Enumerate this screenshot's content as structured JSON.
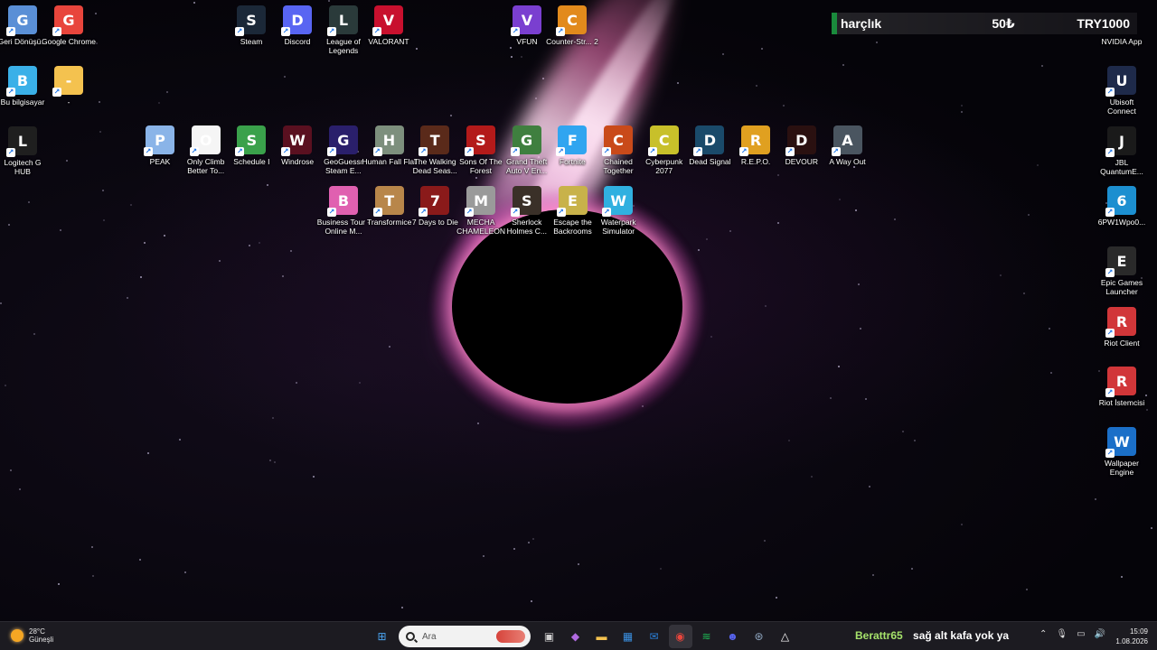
{
  "desktop": {
    "icons_left": [
      {
        "label": "Geri Dönüşü...",
        "icon": "recycle-bin-icon",
        "color": "#5a8fd6"
      },
      {
        "label": "Google Chrome",
        "icon": "chrome-icon",
        "color": "#e8453c"
      },
      {
        "label": "Bu bilgisayar",
        "icon": "computer-icon",
        "color": "#3ab0e8"
      },
      {
        "label": "-",
        "icon": "folder-icon",
        "color": "#f4c24f"
      },
      {
        "label": "Logitech G HUB",
        "icon": "logitech-icon",
        "color": "#1f1f1f"
      }
    ],
    "icons_top": [
      {
        "label": "Steam",
        "icon": "steam-icon",
        "color": "#1b2838"
      },
      {
        "label": "Discord",
        "icon": "discord-icon",
        "color": "#5865f2"
      },
      {
        "label": "League of Legends",
        "icon": "league-icon",
        "color": "#2a3a3a"
      },
      {
        "label": "VALORANT",
        "icon": "valorant-icon",
        "color": "#c8102e"
      },
      {
        "label": "VFUN",
        "icon": "vfun-icon",
        "color": "#7a3fd0"
      },
      {
        "label": "Counter-Str... 2",
        "icon": "cs2-icon",
        "color": "#e28a1c"
      }
    ],
    "icons_row1": [
      {
        "label": "PEAK",
        "icon": "peak-icon",
        "color": "#8ab4e8"
      },
      {
        "label": "Only Climb Better To...",
        "icon": "file-icon",
        "color": "#f5f5f5"
      },
      {
        "label": "Schedule I",
        "icon": "schedule-icon",
        "color": "#3aa14b"
      },
      {
        "label": "Windrose",
        "icon": "windrose-icon",
        "color": "#5a1020"
      },
      {
        "label": "GeoGuessr Steam E...",
        "icon": "geoguessr-icon",
        "color": "#2a1f6b"
      },
      {
        "label": "Human Fall Flat",
        "icon": "hff-icon",
        "color": "#7d8f7d"
      },
      {
        "label": "The Walking Dead Seas...",
        "icon": "twd-icon",
        "color": "#5a2a1a"
      },
      {
        "label": "Sons Of The Forest",
        "icon": "sotf-icon",
        "color": "#b31a1a"
      },
      {
        "label": "Grand Theft Auto V En...",
        "icon": "gta-icon",
        "color": "#3f7f3f"
      },
      {
        "label": "Fortnite",
        "icon": "fortnite-icon",
        "color": "#30a5f0"
      },
      {
        "label": "Chained Together",
        "icon": "chained-icon",
        "color": "#c94a1a"
      },
      {
        "label": "Cyberpunk 2077",
        "icon": "cyberpunk-icon",
        "color": "#c8c02a"
      },
      {
        "label": "Dead Signal",
        "icon": "deadsignal-icon",
        "color": "#1a4a6a"
      },
      {
        "label": "R.E.P.O.",
        "icon": "repo-icon",
        "color": "#e0a020"
      },
      {
        "label": "DEVOUR",
        "icon": "devour-icon",
        "color": "#2a1010"
      },
      {
        "label": "A Way Out",
        "icon": "awayout-icon",
        "color": "#4a5560"
      }
    ],
    "icons_row2": [
      {
        "label": "Business Tour - Online M...",
        "icon": "businesstour-icon",
        "color": "#e060b0"
      },
      {
        "label": "Transformice",
        "icon": "transformice-icon",
        "color": "#b8864a"
      },
      {
        "label": "7 Days to Die",
        "icon": "7days-icon",
        "color": "#8a1a1a"
      },
      {
        "label": "MECHA CHAMELEON",
        "icon": "mecha-icon",
        "color": "#9a9a9a"
      },
      {
        "label": "Sherlock Holmes C...",
        "icon": "sherlock-icon",
        "color": "#3a3028"
      },
      {
        "label": "Escape the Backrooms",
        "icon": "backrooms-icon",
        "color": "#c8b24a"
      },
      {
        "label": "Waterpark Simulator",
        "icon": "waterpark-icon",
        "color": "#30b0e0"
      }
    ],
    "icons_right": [
      {
        "label": "NVIDIA App",
        "icon": "nvidia-icon",
        "color": "#76b900"
      },
      {
        "label": "Ubisoft Connect",
        "icon": "ubisoft-icon",
        "color": "#1e2a4a"
      },
      {
        "label": "JBL QuantumE...",
        "icon": "jbl-icon",
        "color": "#1a1a1a"
      },
      {
        "label": "6PW1Wpo0...",
        "icon": "edge-icon",
        "color": "#1c8fd0"
      },
      {
        "label": "Epic Games Launcher",
        "icon": "epic-icon",
        "color": "#2a2a2a"
      },
      {
        "label": "Riot Client",
        "icon": "riot-icon",
        "color": "#d13639"
      },
      {
        "label": "Riot İstemcisi",
        "icon": "riot-icon",
        "color": "#d13639"
      },
      {
        "label": "Wallpaper Engine",
        "icon": "wallpaper-engine-icon",
        "color": "#1b6fc8"
      }
    ]
  },
  "widget": {
    "name": "harçlık",
    "amount": "50₺",
    "goal": "TRY1000",
    "accent": "#1a8a3c"
  },
  "taskbar": {
    "weather_temp": "28°C",
    "weather_desc": "Güneşli",
    "search_placeholder": "Ara",
    "apps": [
      {
        "name": "windows-start-icon",
        "color": "#4aa3f0"
      },
      {
        "name": "task-view-icon",
        "color": "#cfcfcf"
      },
      {
        "name": "copilot-icon",
        "color": "#b06ae0"
      },
      {
        "name": "file-explorer-icon",
        "color": "#f4c24f"
      },
      {
        "name": "store-icon",
        "color": "#3a8fe0"
      },
      {
        "name": "mail-icon",
        "color": "#2a7fd8"
      },
      {
        "name": "chrome-icon",
        "color": "#e8453c"
      },
      {
        "name": "spotify-icon",
        "color": "#1db954"
      },
      {
        "name": "discord-icon",
        "color": "#5865f2"
      },
      {
        "name": "steam-icon",
        "color": "#8fa6c0"
      },
      {
        "name": "cloud-icon",
        "color": "#ffffff"
      }
    ],
    "ticker_user": "Berattr65",
    "ticker_message": "sağ alt kafa yok ya",
    "time": "15:09",
    "date": "1.08.2026"
  }
}
